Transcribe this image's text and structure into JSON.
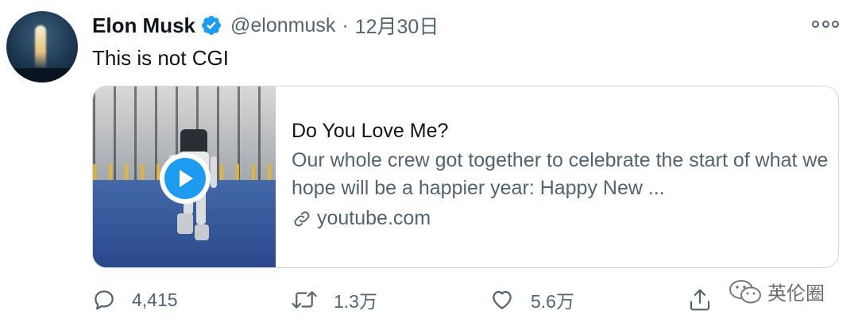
{
  "tweet": {
    "author_name": "Elon Musk",
    "handle": "@elonmusk",
    "separator": "·",
    "date": "12月30日",
    "text": "This is not CGI",
    "icons": {
      "verified": "verified-badge-icon",
      "more": "more-options-icon"
    },
    "accent_color": "#1d9bf0"
  },
  "card": {
    "title": "Do You Love Me?",
    "description": "Our whole crew got together to celebrate the start of what we hope will be a happier year: Happy New ...",
    "link_text": "youtube.com",
    "icons": {
      "play": "play-icon",
      "link": "link-icon"
    }
  },
  "actions": {
    "reply_count": "4,415",
    "retweet_count": "1.3万",
    "like_count": "5.6万",
    "icons": {
      "reply": "reply-icon",
      "retweet": "retweet-icon",
      "like": "heart-icon",
      "share": "share-icon"
    }
  },
  "watermark": {
    "text": "英伦圈",
    "icon": "wechat-icon"
  }
}
